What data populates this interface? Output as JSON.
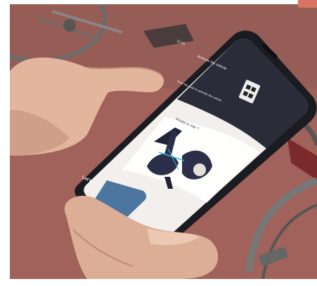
{
  "photo": {
    "subject": "hands holding smartphone with bike unlock app",
    "colors": {
      "floor": "#9c5f55",
      "phone_frame": "#1b1c21",
      "screen_header": "#2b2c3a",
      "screen_body": "#f3f1ee",
      "button": "#4c76a0",
      "skin": "#e0b49a"
    }
  },
  "screen": {
    "status_time": "11:16",
    "header_title": "Activate the vehicle",
    "header_hint": "Scan the code to activate the vehicle",
    "card_title": "Ready to ride ?",
    "button_label": "Let's"
  }
}
